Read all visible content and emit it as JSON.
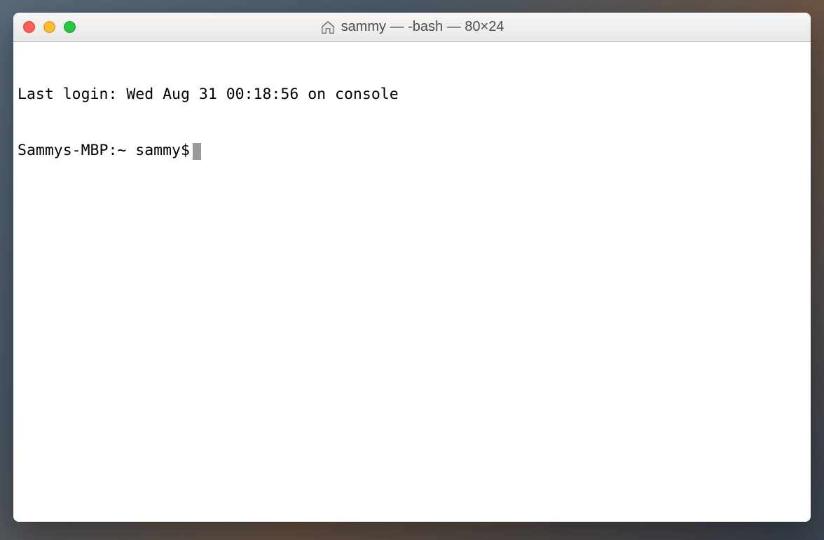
{
  "window": {
    "title": "sammy — -bash — 80×24"
  },
  "terminal": {
    "last_login_line": "Last login: Wed Aug 31 00:18:56 on console",
    "prompt": "Sammys-MBP:~ sammy$"
  }
}
